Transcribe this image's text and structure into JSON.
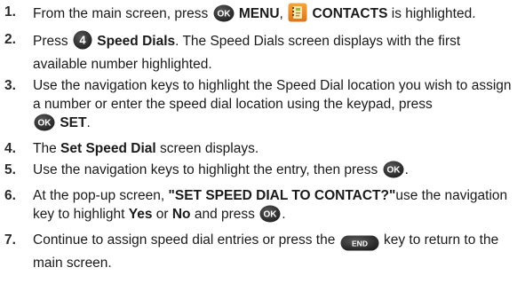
{
  "steps": [
    {
      "number": "1.",
      "text_a": "From the main screen, press ",
      "menu_label": "MENU",
      "text_b": ", ",
      "contacts_label": "CONTACTS",
      "text_c": " is highlighted."
    },
    {
      "number": "2.",
      "text_a": "Press ",
      "speed_dials_label": "Speed Dials",
      "text_b": ". The Speed Dials screen displays with the first available number highlighted."
    },
    {
      "number": "3.",
      "text_a": "Use the navigation keys to highlight the Speed Dial location you wish to assign a number or enter the speed dial location using the keypad, press ",
      "set_label": "SET",
      "text_b": "."
    },
    {
      "number": "4.",
      "text_a": "The ",
      "screen_label": "Set Speed Dial",
      "text_b": " screen displays."
    },
    {
      "number": "5.",
      "text_a": "Use the navigation keys to highlight the entry, then press ",
      "text_b": "."
    },
    {
      "number": "6.",
      "text_a": "At the pop-up screen, ",
      "popup_label": "\"SET SPEED DIAL TO CONTACT?\"",
      "text_b": "use the navigation key to highlight ",
      "yes_label": "Yes",
      "text_c": " or ",
      "no_label": "No",
      "text_d": " and press ",
      "text_e": "."
    },
    {
      "number": "7.",
      "text_a": "Continue to assign speed dial entries or press the ",
      "text_b": " key to return to the main screen."
    }
  ],
  "icons": {
    "ok_key_text": "OK",
    "key_4_text": "4",
    "end_key_text": "END",
    "ok_key_name": "ok-key-icon",
    "key_4_name": "number-4-key-icon",
    "contacts_name": "contacts-icon",
    "end_key_name": "end-key-icon"
  },
  "colors": {
    "key_dark": "#2b2b2b",
    "contacts_orange": "#e38a1c",
    "contacts_green": "#8fbf3a",
    "text": "#1a1a1a"
  }
}
